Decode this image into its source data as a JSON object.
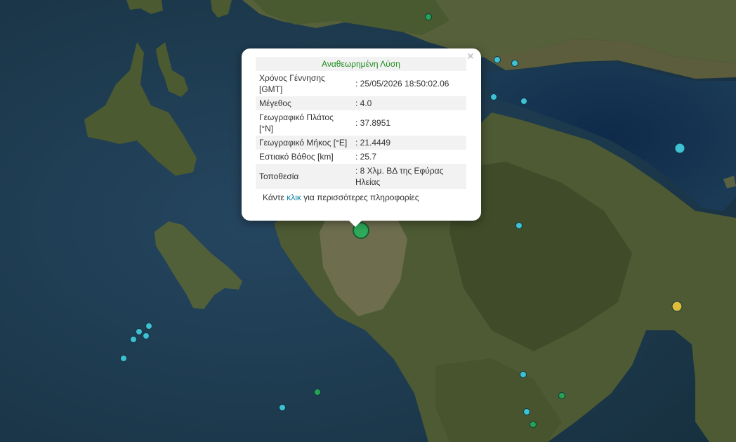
{
  "popup": {
    "title": "Αναθεωρημένη Λύση",
    "close_glyph": "×",
    "rows": [
      {
        "label": "Χρόνος Γέννησης [GMT]",
        "value": ": 25/05/2026 18:50:02.06"
      },
      {
        "label": "Μέγεθος",
        "value": ": 4.0"
      },
      {
        "label": "Γεωγραφικό Πλάτος [°N]",
        "value": ": 37.8951"
      },
      {
        "label": "Γεωγραφικό Μήκος [°E]",
        "value": ": 21.4449"
      },
      {
        "label": "Εστιακό Βάθος [km]",
        "value": ": 25.7"
      },
      {
        "label": "Τοποθεσία",
        "value": ": 8 Χλμ. ΒΔ της Εφύρας Ηλείας"
      }
    ],
    "more_prefix": "Κάντε",
    "more_link": "κλικ",
    "more_suffix": "για περισσότερες πληροφορίες"
  },
  "colors": {
    "sea": "#1f3d52",
    "land": "#4d5a33",
    "selected_event": "#2eaa5a",
    "event_cyan": "#3fc0d4",
    "event_green": "#26a254",
    "event_yellow": "#e0bb37",
    "link": "#0a7ea4",
    "title_green": "#1e8a1e"
  },
  "events": [
    {
      "type": "cyan",
      "magnitude": "small"
    },
    {
      "type": "cyan",
      "magnitude": "small"
    },
    {
      "type": "cyan",
      "magnitude": "small"
    },
    {
      "type": "cyan",
      "magnitude": "small"
    },
    {
      "type": "cyan",
      "magnitude": "medium"
    },
    {
      "type": "cyan",
      "magnitude": "small"
    },
    {
      "type": "cyan",
      "magnitude": "small"
    },
    {
      "type": "cyan",
      "magnitude": "small"
    },
    {
      "type": "cyan",
      "magnitude": "small"
    },
    {
      "type": "cyan",
      "magnitude": "small"
    },
    {
      "type": "cyan",
      "magnitude": "small"
    },
    {
      "type": "cyan",
      "magnitude": "small"
    },
    {
      "type": "cyan",
      "magnitude": "small"
    },
    {
      "type": "cyan",
      "magnitude": "small"
    },
    {
      "type": "cyan",
      "magnitude": "small"
    },
    {
      "type": "green",
      "magnitude": "small"
    },
    {
      "type": "green",
      "magnitude": "small"
    },
    {
      "type": "green",
      "magnitude": "small"
    },
    {
      "type": "green",
      "magnitude": "small"
    },
    {
      "type": "yellow",
      "magnitude": "medium"
    },
    {
      "type": "selected",
      "magnitude": "large"
    }
  ]
}
